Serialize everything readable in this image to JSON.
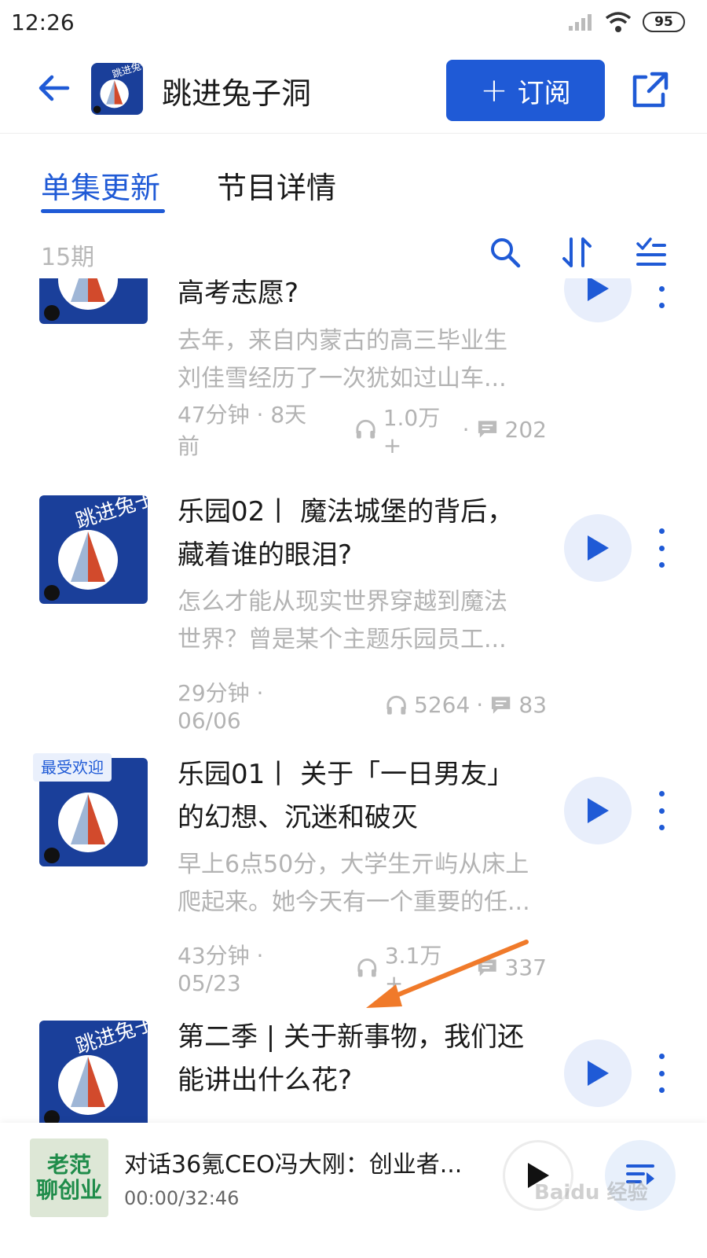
{
  "status_bar": {
    "time": "12:26",
    "battery": "95"
  },
  "header": {
    "title": "跳进兔子洞",
    "subscribe_label": "订阅"
  },
  "tabs": [
    {
      "label": "单集更新"
    },
    {
      "label": "节目详情"
    }
  ],
  "toolbar": {
    "episode_count": "15期"
  },
  "episodes": [
    {
      "title_lines": [
        "高考志愿?"
      ],
      "desc_lines": [
        "去年，来自内蒙古的高三毕业生",
        "刘佳雪经历了一次犹如过山车..."
      ],
      "duration_date": "47分钟 · 8天前",
      "plays": "1.0万+",
      "comments": "202"
    },
    {
      "title_lines": [
        "乐园02丨 魔法城堡的背后，",
        "藏着谁的眼泪?"
      ],
      "desc_lines": [
        "怎么才能从现实世界穿越到魔法",
        "世界？曾是某个主题乐园员工..."
      ],
      "duration_date": "29分钟 · 06/06",
      "plays": "5264",
      "comments": "83"
    },
    {
      "badge": "最受欢迎",
      "title_lines": [
        "乐园01丨 关于「一日男友」",
        "的幻想、沉迷和破灭"
      ],
      "desc_lines": [
        "早上6点50分，大学生亓屿从床上",
        "爬起来。她今天有一个重要的任..."
      ],
      "duration_date": "43分钟 · 05/23",
      "plays": "3.1万+",
      "comments": "337"
    },
    {
      "title_lines": [
        "第二季 | 关于新事物，我们还",
        "能讲出什么花?"
      ]
    }
  ],
  "mini_player": {
    "cover_line1": "老范",
    "cover_line2": "聊创业",
    "title": "对话36氪CEO冯大刚：创业者...",
    "time": "00:00/32:46"
  },
  "watermark": "Baidu 经验",
  "colors": {
    "accent": "#1f5ad6",
    "muted_text": "#b3b3b3",
    "annotation_arrow": "#f07a2a"
  }
}
